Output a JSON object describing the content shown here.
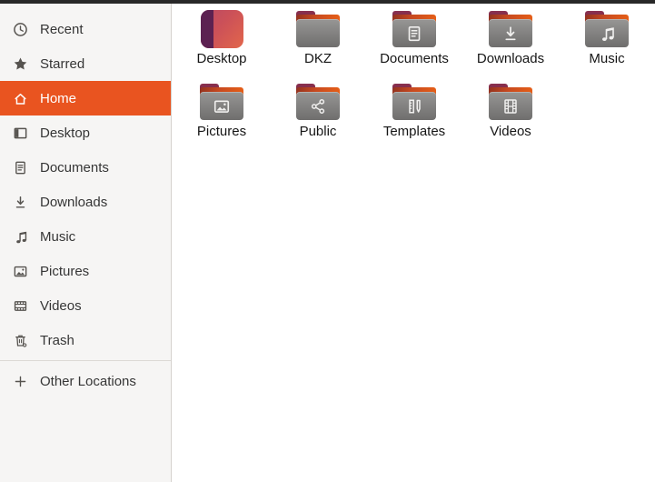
{
  "window": {
    "top_edge_color": "#282828"
  },
  "colors": {
    "accent": "#E95420",
    "sidebar_bg": "#f6f5f4",
    "sidebar_border": "#d5d2ce",
    "folder_gray": "#797877",
    "folder_flap_maroon": "#7b2b44",
    "folder_flap_orange": "#e65f17"
  },
  "sidebar": {
    "items": [
      {
        "label": "Recent",
        "icon": "clock",
        "selected": false
      },
      {
        "label": "Starred",
        "icon": "star",
        "selected": false
      },
      {
        "label": "Home",
        "icon": "home",
        "selected": true
      },
      {
        "label": "Desktop",
        "icon": "desktop",
        "selected": false
      },
      {
        "label": "Documents",
        "icon": "document",
        "selected": false
      },
      {
        "label": "Downloads",
        "icon": "download",
        "selected": false
      },
      {
        "label": "Music",
        "icon": "music",
        "selected": false
      },
      {
        "label": "Pictures",
        "icon": "picture",
        "selected": false
      },
      {
        "label": "Videos",
        "icon": "film",
        "selected": false
      },
      {
        "label": "Trash",
        "icon": "trash",
        "selected": false
      },
      {
        "separator": true
      },
      {
        "label": "Other Locations",
        "icon": "plus",
        "selected": false
      }
    ]
  },
  "main": {
    "items": [
      {
        "label": "Desktop",
        "kind": "desktop-tile",
        "glyph": ""
      },
      {
        "label": "DKZ",
        "kind": "folder",
        "glyph": ""
      },
      {
        "label": "Documents",
        "kind": "folder",
        "glyph": "document"
      },
      {
        "label": "Downloads",
        "kind": "folder",
        "glyph": "download"
      },
      {
        "label": "Music",
        "kind": "folder",
        "glyph": "music"
      },
      {
        "label": "Pictures",
        "kind": "folder",
        "glyph": "picture"
      },
      {
        "label": "Public",
        "kind": "folder",
        "glyph": "share"
      },
      {
        "label": "Templates",
        "kind": "folder",
        "glyph": "template"
      },
      {
        "label": "Videos",
        "kind": "folder",
        "glyph": "filmv"
      }
    ]
  }
}
